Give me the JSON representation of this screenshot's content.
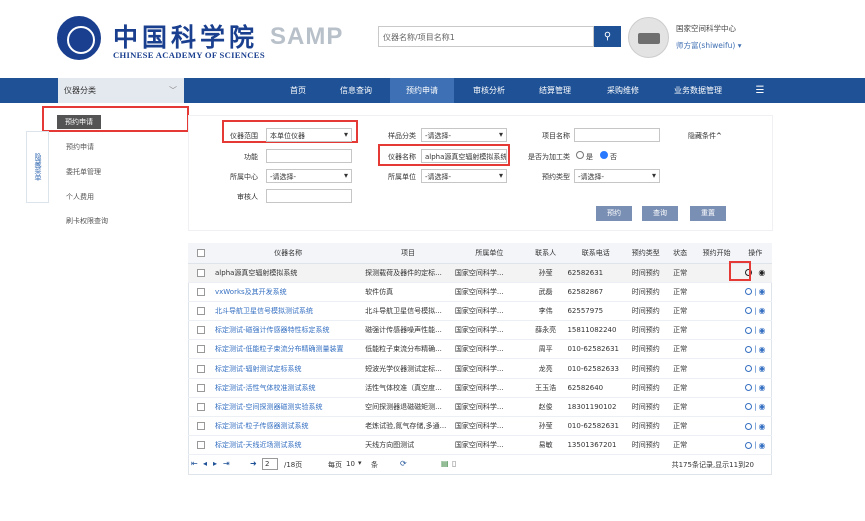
{
  "header": {
    "logo_cn": "中国科学院",
    "logo_en": "CHINESE ACADEMY OF SCIENCES",
    "logo_samp": "SAMP",
    "search_placeholder": "仪器名称/项目名称1",
    "user_org": "国家空间科学中心",
    "user_name": "师方富(shiweifu) ▾"
  },
  "nav": {
    "category_label": "仪器分类",
    "items": [
      "首页",
      "信息查询",
      "预约申请",
      "审核分析",
      "结算管理",
      "采购维修",
      "业务数据管理",
      "☰"
    ],
    "active_index": 2
  },
  "sidebar": {
    "title": "预约申请",
    "items": [
      "预约申请",
      "委托单管理",
      "个人费用",
      "刷卡权限查询"
    ],
    "collapse_label": "隐藏菜单"
  },
  "filters": {
    "instrument_scope_label": "仪器范围",
    "instrument_scope_value": "本单位仪器",
    "sample_category_label": "样品分类",
    "sample_category_value": "-请选择-",
    "project_name_label": "项目名称",
    "project_name_value": "",
    "hide_conditions_label": "隐藏条件",
    "function_label": "功能",
    "function_value": "",
    "instrument_name_label": "仪器名称",
    "instrument_name_value": "alpha源真空辐射模拟系统",
    "is_processing_label": "是否为加工类",
    "radio_yes": "是",
    "radio_no": "否",
    "center_label": "所属中心",
    "center_value": "-请选择-",
    "unit_label": "所属单位",
    "unit_value": "-请选择-",
    "booking_type_label": "预约类型",
    "booking_type_value": "-请选择-",
    "reviewer_label": "审核人",
    "reviewer_value": "",
    "btn_book": "预约",
    "btn_search": "查询",
    "btn_reset": "重置"
  },
  "table": {
    "headers": [
      "仪器名称",
      "项目",
      "所属单位",
      "联系人",
      "联系电话",
      "预约类型",
      "状态",
      "预约开始",
      "操作"
    ],
    "rows": [
      {
        "name": "alpha源真空辐射模拟系统",
        "project": "探测载荷及器件的定标...",
        "unit": "国家空间科学...",
        "contact": "孙莹",
        "phone": "62582631",
        "type": "时间预约",
        "status": "正常",
        "start": ""
      },
      {
        "name": "vxWorks及其开发系统",
        "project": "软件仿真",
        "unit": "国家空间科学...",
        "contact": "武磊",
        "phone": "62582867",
        "type": "时间预约",
        "status": "正常",
        "start": ""
      },
      {
        "name": "北斗导航卫星信号模拟测试系统",
        "project": "北斗导航卫星信号模拟...",
        "unit": "国家空间科学...",
        "contact": "李伟",
        "phone": "62557975",
        "type": "时间预约",
        "status": "正常",
        "start": ""
      },
      {
        "name": "标定测试-磁强计传感器特性标定系统",
        "project": "磁强计传感器噪声性能...",
        "unit": "国家空间科学...",
        "contact": "薛永亮",
        "phone": "15811082240",
        "type": "时间预约",
        "status": "正常",
        "start": ""
      },
      {
        "name": "标定测试-低能粒子束流分布精确测量装置",
        "project": "低能粒子束流分布精确...",
        "unit": "国家空间科学...",
        "contact": "周平",
        "phone": "010-62582631",
        "type": "时间预约",
        "status": "正常",
        "start": ""
      },
      {
        "name": "标定测试-辐射测试定标系统",
        "project": "短波光学仪器测试定标...",
        "unit": "国家空间科学...",
        "contact": "龙亮",
        "phone": "010-62582633",
        "type": "时间预约",
        "status": "正常",
        "start": ""
      },
      {
        "name": "标定测试-活性气体校准测试系统",
        "project": "活性气体校准（真空度...",
        "unit": "国家空间科学...",
        "contact": "王玉浩",
        "phone": "62582640",
        "type": "时间预约",
        "status": "正常",
        "start": ""
      },
      {
        "name": "标定测试-空间探测器磁测实验系统",
        "project": "空间探测器退磁磁矩测...",
        "unit": "国家空间科学...",
        "contact": "赵俊",
        "phone": "18301190102",
        "type": "时间预约",
        "status": "正常",
        "start": ""
      },
      {
        "name": "标定测试-粒子传感器测试系统",
        "project": "老炼试验,氮气存储,多通...",
        "unit": "国家空间科学...",
        "contact": "孙莹",
        "phone": "010-62582631",
        "type": "时间预约",
        "status": "正常",
        "start": ""
      },
      {
        "name": "标定测试-天线近场测试系统",
        "project": "天线方向图测试",
        "unit": "国家空间科学...",
        "contact": "易敏",
        "phone": "13501367201",
        "type": "时间预约",
        "status": "正常",
        "start": ""
      }
    ]
  },
  "pager": {
    "page_value": "2",
    "total_pages": "/18页",
    "per_page_label": "每页",
    "per_page_value": "10",
    "per_page_unit": "条",
    "summary": "共175条记录,显示11到20"
  }
}
